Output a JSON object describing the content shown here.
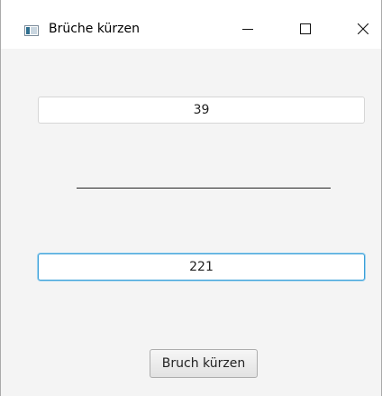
{
  "window": {
    "title": "Brüche kürzen",
    "controls": {
      "minimize_icon": "minimize-icon",
      "maximize_icon": "maximize-icon",
      "close_icon": "close-icon"
    },
    "app_icon": "window-app-icon"
  },
  "form": {
    "numerator_value": "39",
    "denominator_value": "221",
    "reduce_button_label": "Bruch kürzen",
    "focused_field": "denominator"
  },
  "colors": {
    "focus_accent": "#3a9fd8",
    "background": "#f4f4f4",
    "titlebar": "#ffffff"
  }
}
